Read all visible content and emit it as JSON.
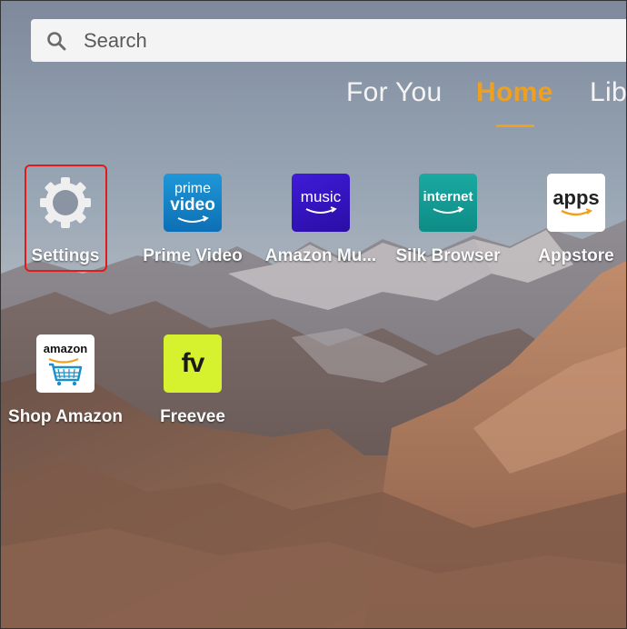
{
  "search": {
    "placeholder": "Search"
  },
  "tabs": [
    {
      "label": "For You"
    },
    {
      "label": "Home",
      "active": true
    },
    {
      "label": "Lib"
    }
  ],
  "apps": [
    {
      "label": "Settings",
      "icon": "gear-icon",
      "tile_text": []
    },
    {
      "label": "Prime Video",
      "icon": "prime-video-icon",
      "tile_text": [
        "prime",
        "video"
      ]
    },
    {
      "label": "Amazon Mu...",
      "icon": "amazon-music-icon",
      "tile_text": [
        "music"
      ]
    },
    {
      "label": "Silk Browser",
      "icon": "silk-browser-icon",
      "tile_text": [
        "internet"
      ]
    },
    {
      "label": "Appstore",
      "icon": "appstore-icon",
      "tile_text": [
        "apps"
      ]
    },
    {
      "label": "Shop Amazon",
      "icon": "shop-amazon-icon",
      "tile_text": [
        "amazon"
      ]
    },
    {
      "label": "Freevee",
      "icon": "freevee-icon",
      "tile_text": [
        "fv"
      ]
    }
  ],
  "colors": {
    "accent": "#f0a020",
    "highlight": "#e01b1b",
    "prime": "#1e97d8",
    "music": "#3f1bd8",
    "silk": "#1aa9a1",
    "freevee": "#d6f22e"
  }
}
